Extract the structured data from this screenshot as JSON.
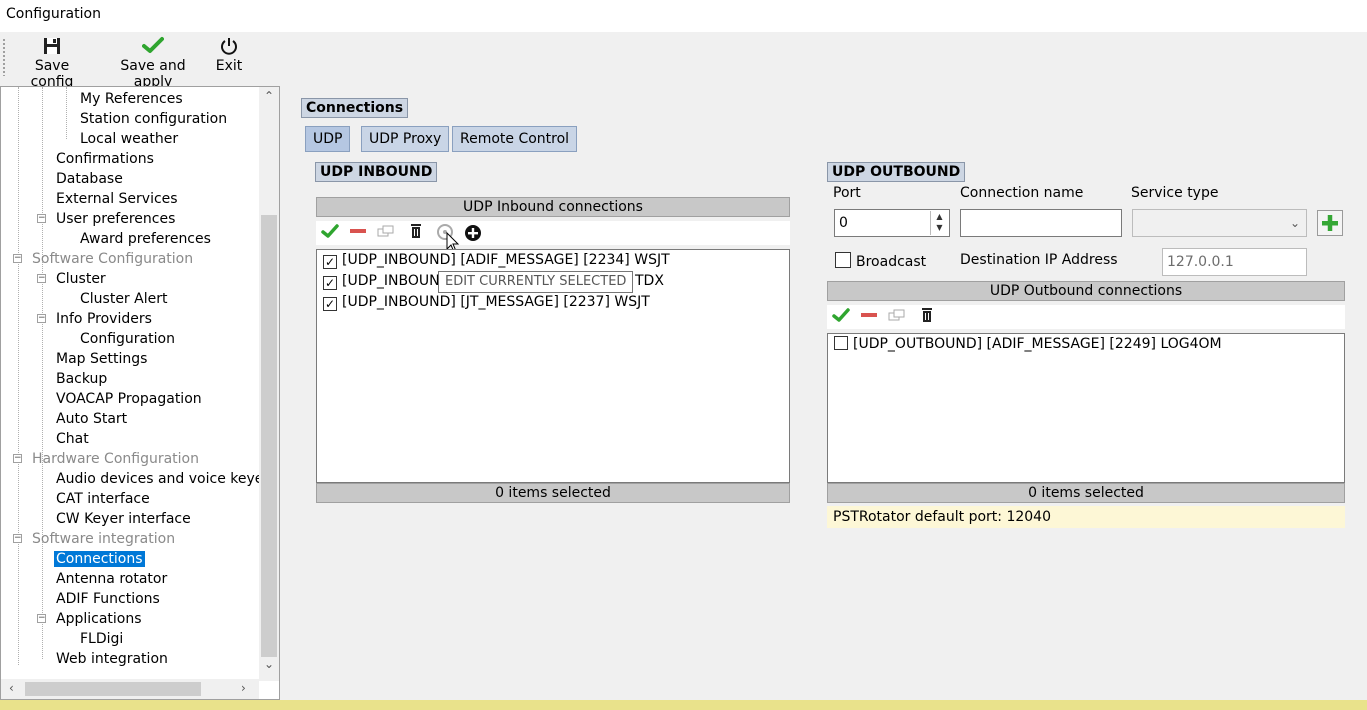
{
  "window": {
    "title": "Configuration"
  },
  "toolbar": {
    "save_config": "Save config",
    "save_apply": "Save and apply",
    "exit": "Exit"
  },
  "tree": {
    "items": [
      {
        "label": "My References"
      },
      {
        "label": "Station configuration"
      },
      {
        "label": "Local weather"
      },
      {
        "label": "Confirmations"
      },
      {
        "label": "Database"
      },
      {
        "label": "External Services"
      },
      {
        "label": "User preferences"
      },
      {
        "label": "Award preferences"
      },
      {
        "label": "Software Configuration"
      },
      {
        "label": "Cluster"
      },
      {
        "label": "Cluster Alert"
      },
      {
        "label": "Info Providers"
      },
      {
        "label": "Configuration"
      },
      {
        "label": "Map Settings"
      },
      {
        "label": "Backup"
      },
      {
        "label": "VOACAP Propagation"
      },
      {
        "label": "Auto Start"
      },
      {
        "label": "Chat"
      },
      {
        "label": "Hardware Configuration"
      },
      {
        "label": "Audio devices and voice keye"
      },
      {
        "label": "CAT interface"
      },
      {
        "label": "CW Keyer interface"
      },
      {
        "label": "Software integration"
      },
      {
        "label": "Connections"
      },
      {
        "label": "Antenna rotator"
      },
      {
        "label": "ADIF Functions"
      },
      {
        "label": "Applications"
      },
      {
        "label": "FLDigi"
      },
      {
        "label": "Web integration"
      }
    ]
  },
  "content": {
    "section_title": "Connections",
    "tabs": [
      "UDP",
      "UDP Proxy",
      "Remote Control"
    ],
    "inbound": {
      "title": "UDP INBOUND",
      "header": "UDP Inbound connections",
      "rows": [
        {
          "text": "[UDP_INBOUND] [ADIF_MESSAGE] [2234] WSJT",
          "checked": true
        },
        {
          "text": "[UDP_INBOUN",
          "tail": "TDX",
          "checked": true
        },
        {
          "text": "[UDP_INBOUND] [JT_MESSAGE] [2237] WSJT",
          "checked": true
        }
      ],
      "tooltip": "EDIT CURRENTLY SELECTED",
      "footer": "0 items selected"
    },
    "outbound": {
      "title": "UDP OUTBOUND",
      "port_label": "Port",
      "port_value": "0",
      "conn_name_label": "Connection name",
      "conn_name_value": "",
      "service_type_label": "Service type",
      "broadcast_label": "Broadcast",
      "dest_ip_label": "Destination IP Address",
      "dest_ip_value": "127.0.0.1",
      "header": "UDP Outbound connections",
      "rows": [
        {
          "text": "[UDP_OUTBOUND] [ADIF_MESSAGE] [2249] LOG4OM",
          "checked": false
        }
      ],
      "footer": "0 items selected",
      "note": "PSTRotator default port: 12040"
    }
  },
  "colors": {
    "selection": "#0078d7",
    "green_check": "#2fa52f",
    "red_minus": "#d9534f",
    "note_bg": "#fdf7d6"
  }
}
